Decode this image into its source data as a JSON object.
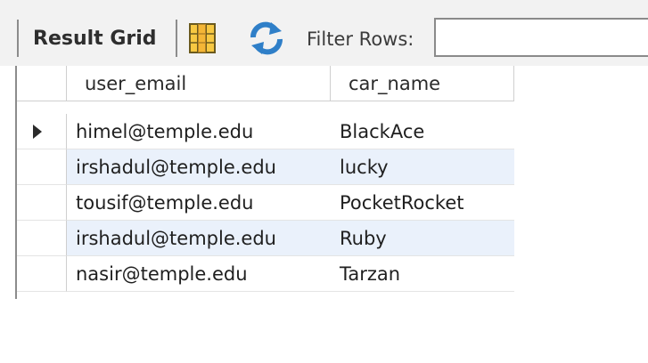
{
  "toolbar": {
    "result_grid_label": "Result Grid",
    "layout_icon": "grid-layout-icon",
    "refresh_icon": "refresh-icon",
    "filter_label": "Filter Rows:",
    "filter_value": "",
    "filter_placeholder": ""
  },
  "grid": {
    "columns": [
      "user_email",
      "car_name"
    ],
    "rows": [
      {
        "user_email": "himel@temple.edu",
        "car_name": "BlackAce",
        "selected": true
      },
      {
        "user_email": "irshadul@temple.edu",
        "car_name": "lucky",
        "selected": false
      },
      {
        "user_email": "tousif@temple.edu",
        "car_name": "PocketRocket",
        "selected": false
      },
      {
        "user_email": "irshadul@temple.edu",
        "car_name": "Ruby",
        "selected": false
      },
      {
        "user_email": "nasir@temple.edu",
        "car_name": "Tarzan",
        "selected": false
      }
    ],
    "selected_row_icon": "row-pointer-icon",
    "colors": {
      "toolbar_bg": "#f2f2f2",
      "alt_row_bg": "#eaf1fb",
      "separator": "#8c8c8c"
    }
  }
}
